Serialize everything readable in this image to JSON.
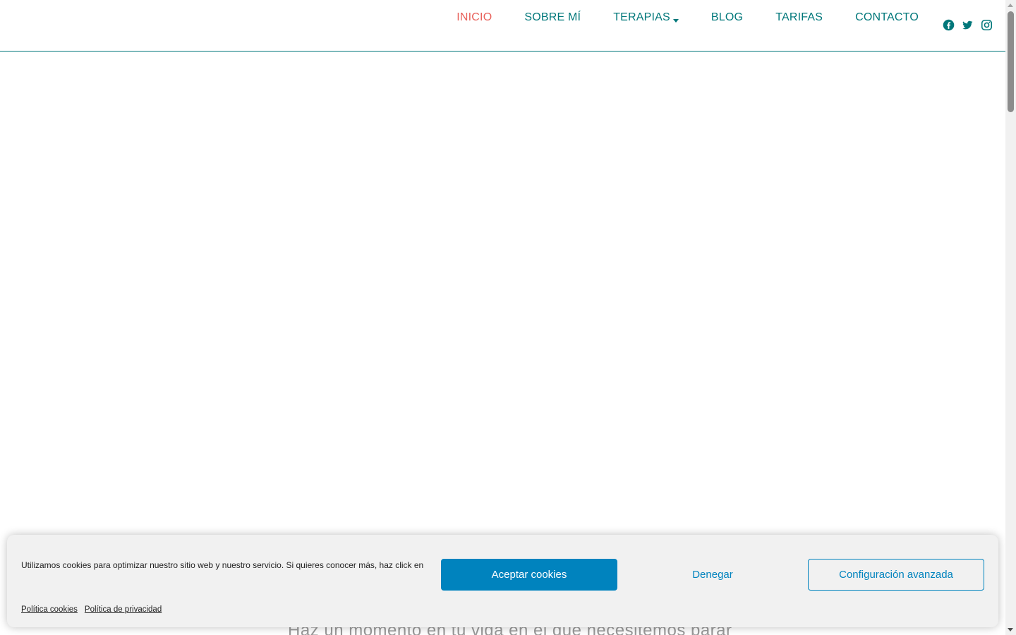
{
  "nav": {
    "items": [
      {
        "label": "INICIO",
        "active": true
      },
      {
        "label": "SOBRE MÍ",
        "active": false
      },
      {
        "label": "TERAPIAS",
        "active": false,
        "dropdown": true
      },
      {
        "label": "BLOG",
        "active": false
      },
      {
        "label": "TARIFAS",
        "active": false
      },
      {
        "label": "CONTACTO",
        "active": false
      }
    ],
    "social": [
      {
        "icon": "facebook-icon"
      },
      {
        "icon": "twitter-icon"
      },
      {
        "icon": "instagram-icon"
      }
    ]
  },
  "content": {
    "partial_heading": "Haz un momento en tu vida en el que necesitemos parar"
  },
  "cookie_banner": {
    "message": "Utilizamos cookies para optimizar nuestro sitio web y nuestro servicio. Si quieres conocer más, haz click en",
    "accept_label": "Aceptar cookies",
    "deny_label": "Denegar",
    "config_label": "Configuración avanzada",
    "links": [
      "Política cookies",
      "Política de privacidad"
    ]
  },
  "colors": {
    "nav": "#00777a",
    "active": "#e8605a",
    "button": "#0083be",
    "banner_bg": "#f1f1f1"
  }
}
